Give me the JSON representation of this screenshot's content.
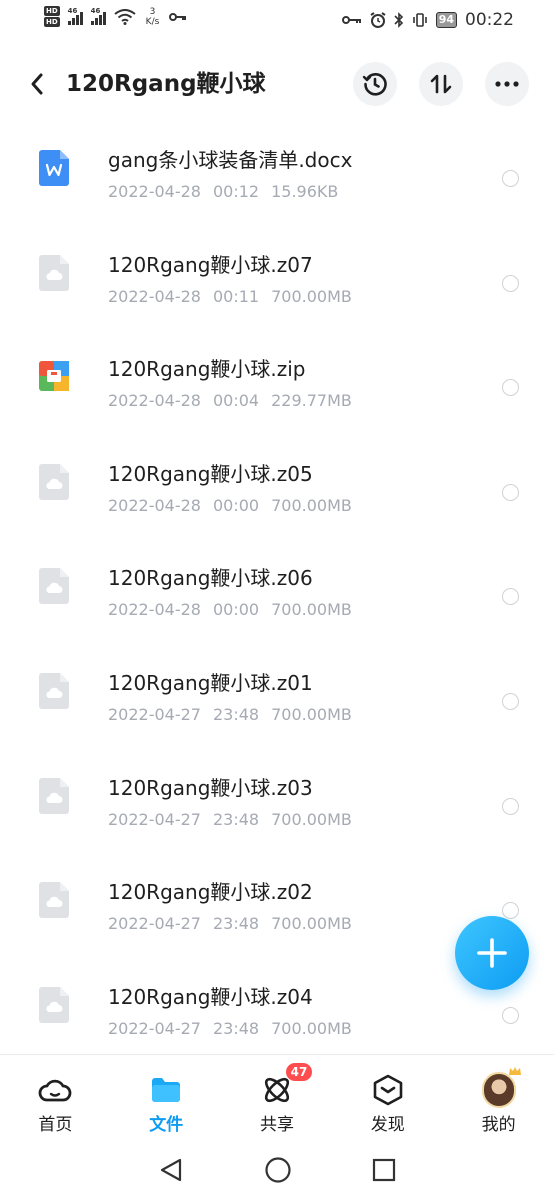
{
  "status_bar": {
    "network": "46",
    "speed_value": "3",
    "speed_unit": "K/s",
    "battery": "94",
    "time": "00:22"
  },
  "header": {
    "title": "120Rgang鞭小球"
  },
  "files": [
    {
      "name": "gang条小球装备清单.docx",
      "date": "2022-04-28",
      "time": "00:12",
      "size": "15.96KB",
      "icon": "word-doc-icon"
    },
    {
      "name": "120Rgang鞭小球.z07",
      "date": "2022-04-28",
      "time": "00:11",
      "size": "700.00MB",
      "icon": "cloud-file-icon"
    },
    {
      "name": "120Rgang鞭小球.zip",
      "date": "2022-04-28",
      "time": "00:04",
      "size": "229.77MB",
      "icon": "zip-archive-icon"
    },
    {
      "name": "120Rgang鞭小球.z05",
      "date": "2022-04-28",
      "time": "00:00",
      "size": "700.00MB",
      "icon": "cloud-file-icon"
    },
    {
      "name": "120Rgang鞭小球.z06",
      "date": "2022-04-28",
      "time": "00:00",
      "size": "700.00MB",
      "icon": "cloud-file-icon"
    },
    {
      "name": "120Rgang鞭小球.z01",
      "date": "2022-04-27",
      "time": "23:48",
      "size": "700.00MB",
      "icon": "cloud-file-icon"
    },
    {
      "name": "120Rgang鞭小球.z03",
      "date": "2022-04-27",
      "time": "23:48",
      "size": "700.00MB",
      "icon": "cloud-file-icon"
    },
    {
      "name": "120Rgang鞭小球.z02",
      "date": "2022-04-27",
      "time": "23:48",
      "size": "700.00MB",
      "icon": "cloud-file-icon"
    },
    {
      "name": "120Rgang鞭小球.z04",
      "date": "2022-04-27",
      "time": "23:48",
      "size": "700.00MB",
      "icon": "cloud-file-icon"
    }
  ],
  "tabbar": {
    "tabs": [
      {
        "label": "首页",
        "icon": "home-cloud-icon"
      },
      {
        "label": "文件",
        "icon": "folder-icon"
      },
      {
        "label": "共享",
        "icon": "atom-share-icon",
        "badge": "47"
      },
      {
        "label": "发现",
        "icon": "discover-icon"
      },
      {
        "label": "我的",
        "icon": "avatar"
      }
    ],
    "active_index": 1
  },
  "colors": {
    "accent": "#0d9cf2",
    "badge": "#ff4d4f",
    "meta_text": "#a6aab3"
  }
}
